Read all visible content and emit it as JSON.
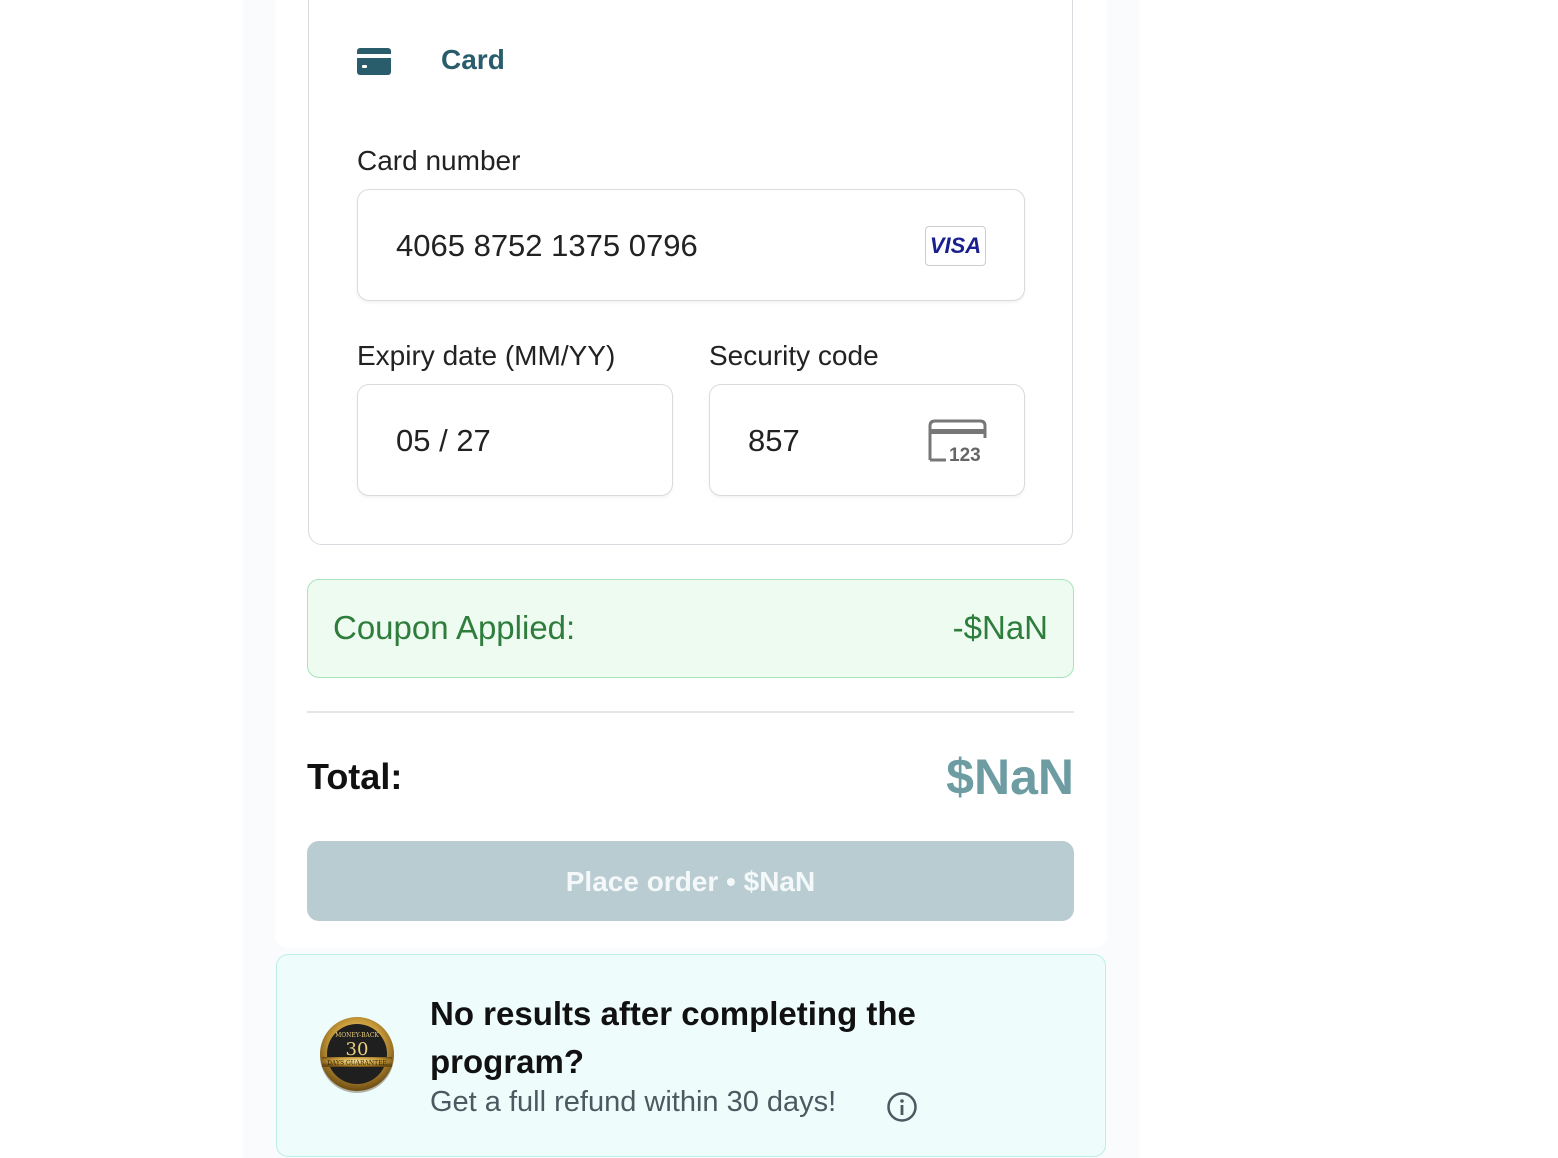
{
  "payment": {
    "method_label": "Card",
    "card_number_label": "Card number",
    "card_number_value": "4065 8752 1375 0796",
    "card_brand": "VISA",
    "expiry_label": "Expiry date (MM/YY)",
    "expiry_value": "05 / 27",
    "security_label": "Security code",
    "security_value": "857",
    "cvc_icon_text": "123"
  },
  "coupon": {
    "label": "Coupon Applied:",
    "value": "-$NaN"
  },
  "total": {
    "label": "Total:",
    "value": "$NaN"
  },
  "place_order": {
    "label": "Place order • $NaN"
  },
  "guarantee": {
    "title": "No results after completing the program?",
    "subtitle": "Get a full refund within 30 days!",
    "badge_number": "30",
    "badge_top_text": "MONEY-BACK",
    "badge_bottom_text": "DAYS GUARANTEE"
  },
  "colors": {
    "brand": "#2a5d6b",
    "coupon_green": "#2e7d3c",
    "total_teal": "#6d9ca3",
    "button_disabled": "#b8ccd1"
  }
}
